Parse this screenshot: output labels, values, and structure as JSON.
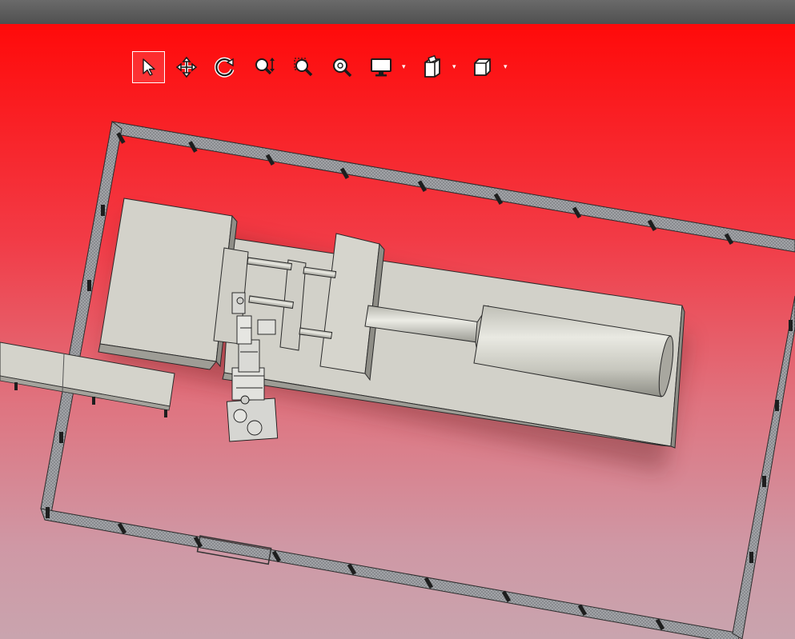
{
  "window": {
    "title": ""
  },
  "toolbar": {
    "tools": [
      {
        "id": "select",
        "icon": "cursor-arrow-icon",
        "active": true
      },
      {
        "id": "pan",
        "icon": "move-arrows-icon",
        "active": false
      },
      {
        "id": "rotate",
        "icon": "rotate-icon",
        "active": false
      },
      {
        "id": "zoom",
        "icon": "zoom-updown-icon",
        "active": false
      },
      {
        "id": "zoom-window",
        "icon": "zoom-window-icon",
        "active": false
      },
      {
        "id": "zoom-fit",
        "icon": "zoom-fit-icon",
        "active": false
      },
      {
        "id": "display",
        "icon": "monitor-icon",
        "dropdown": true
      },
      {
        "id": "view-orient",
        "icon": "view-orientation-icon",
        "dropdown": true
      },
      {
        "id": "box-view",
        "icon": "cube-icon",
        "dropdown": true
      }
    ],
    "caret": "▾"
  },
  "viewport": {
    "background_top": "#ff0a0a",
    "background_bottom": "#c9a4ae",
    "model_color": "#d4d3cb",
    "fence_color": "#9aa0a6",
    "objects": [
      "safety-fence",
      "injection-molding-machine",
      "robot-arm",
      "conveyor"
    ]
  }
}
